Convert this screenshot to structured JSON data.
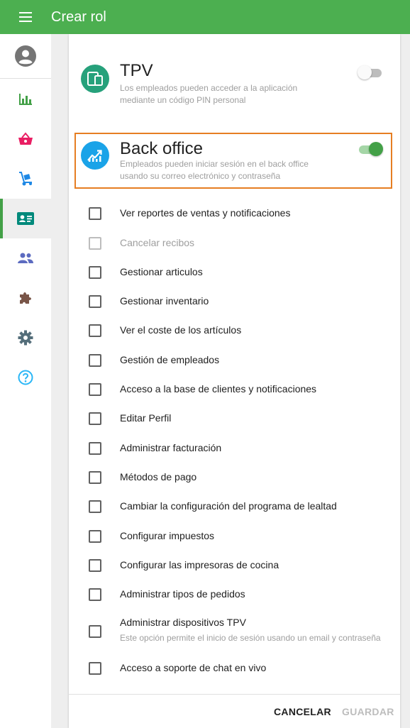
{
  "header": {
    "title": "Crear rol"
  },
  "sidebar": {
    "items": [
      {
        "name": "reports",
        "icon": "bar-chart-icon"
      },
      {
        "name": "items",
        "icon": "basket-icon"
      },
      {
        "name": "inventory",
        "icon": "hand-truck-icon"
      },
      {
        "name": "employees",
        "icon": "id-card-icon",
        "active": true
      },
      {
        "name": "customers",
        "icon": "people-icon"
      },
      {
        "name": "integrations",
        "icon": "puzzle-icon"
      },
      {
        "name": "settings",
        "icon": "gear-icon"
      },
      {
        "name": "help",
        "icon": "help-icon"
      }
    ]
  },
  "roles": {
    "tpv": {
      "title": "TPV",
      "description": "Los empleados pueden acceder a la aplicación mediante un código PIN personal",
      "enabled": false
    },
    "backoffice": {
      "title": "Back office",
      "description": "Empleados pueden iniciar sesión en el back office usando su correo electrónico y contraseña",
      "enabled": true
    }
  },
  "permissions": [
    {
      "label": "Ver reportes de ventas y notificaciones",
      "disabled": false
    },
    {
      "label": "Cancelar recibos",
      "disabled": true
    },
    {
      "label": "Gestionar articulos",
      "disabled": false
    },
    {
      "label": "Gestionar inventario",
      "disabled": false
    },
    {
      "label": "Ver el coste de los artículos",
      "disabled": false
    },
    {
      "label": "Gestión de empleados",
      "disabled": false
    },
    {
      "label": "Acceso a la base de clientes y notificaciones",
      "disabled": false
    },
    {
      "label": "Editar Perfil",
      "disabled": false
    },
    {
      "label": "Administrar facturación",
      "disabled": false
    },
    {
      "label": "Métodos de pago",
      "disabled": false
    },
    {
      "label": "Cambiar la configuración del programa de lealtad",
      "disabled": false
    },
    {
      "label": "Configurar impuestos",
      "disabled": false
    },
    {
      "label": "Configurar las impresoras de cocina",
      "disabled": false
    },
    {
      "label": "Administrar tipos de pedidos",
      "disabled": false
    },
    {
      "label": "Administrar dispositivos TPV",
      "disabled": false,
      "sub": "Este opción permite el inicio de sesión usando un email y contraseña"
    },
    {
      "label": "Acceso a soporte de chat en vivo",
      "disabled": false
    }
  ],
  "footer": {
    "cancel_label": "CANCELAR",
    "save_label": "GUARDAR"
  },
  "colors": {
    "brand": "#4caf50",
    "toggle_on": "#43a047",
    "highlight": "#e67e22"
  }
}
